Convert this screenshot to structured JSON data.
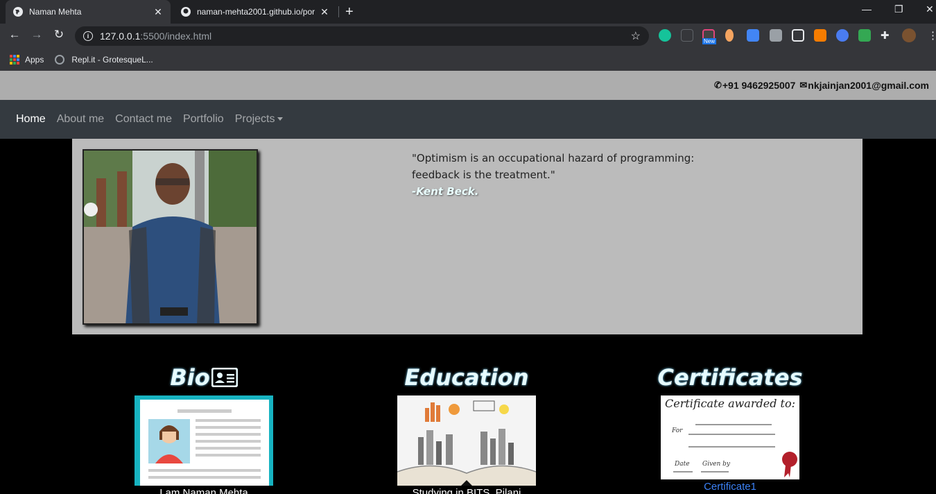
{
  "browser": {
    "tabs": [
      {
        "title": "Naman Mehta",
        "active": true
      },
      {
        "title": "naman-mehta2001.github.io/por",
        "active": false
      }
    ],
    "url_host": "127.0.0.1",
    "url_path": ":5500/index.html",
    "bookmarks": [
      {
        "label": "Apps",
        "icon": "apps-grid-icon"
      },
      {
        "label": "Repl.it - GrotesqueL...",
        "icon": "replit-icon"
      }
    ],
    "extension_badge": "New"
  },
  "contact": {
    "phone": "+91 9462925007",
    "email": "nkjainjan2001@gmail.com"
  },
  "nav": {
    "items": [
      {
        "label": "Home",
        "active": true
      },
      {
        "label": "About me",
        "active": false
      },
      {
        "label": "Contact me",
        "active": false
      },
      {
        "label": "Portfolio",
        "active": false
      },
      {
        "label": "Projects",
        "active": false,
        "dropdown": true
      }
    ]
  },
  "hero": {
    "quote": "\"Optimism is an occupational hazard of programming: feedback is the treatment.\"",
    "author": "-Kent Beck."
  },
  "sections": [
    {
      "title": "Bio",
      "caption": "I am Naman Mehta",
      "icon": "id-card-icon"
    },
    {
      "title": "Education",
      "caption": "Studying in BITS, Pilani"
    },
    {
      "title": "Certificates",
      "caption": "Certificate1",
      "image_text": {
        "heading": "Certificate awarded to:",
        "for": "For",
        "date": "Date",
        "given_by": "Given by"
      }
    }
  ],
  "colors": {
    "contact_bar": "#adadad",
    "navbar": "#343a40",
    "hero_bg": "#bbbbbb",
    "link": "#3c82f6"
  }
}
